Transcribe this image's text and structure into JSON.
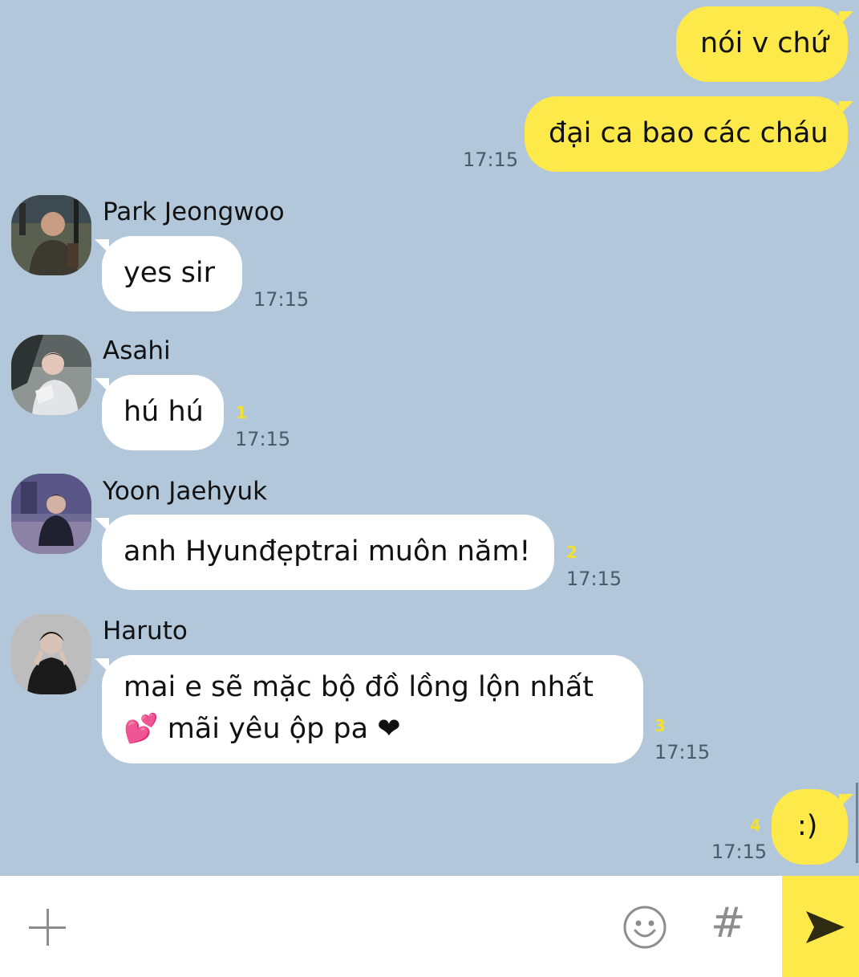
{
  "messages_out_top": [
    {
      "text": "nói v chứ"
    },
    {
      "text": "đại ca bao các cháu",
      "time": "17:15"
    }
  ],
  "incoming": [
    {
      "sender": "Park Jeongwoo",
      "text": "yes sir",
      "time": "17:15",
      "unread": ""
    },
    {
      "sender": "Asahi",
      "text": "hú hú",
      "time": "17:15",
      "unread": "1"
    },
    {
      "sender": "Yoon Jaehyuk",
      "text": "anh Hyunđẹptrai muôn năm!",
      "time": "17:15",
      "unread": "2"
    },
    {
      "sender": "Haruto",
      "line1": "mai e sẽ mặc bộ đồ lồng lộn nhất",
      "line2": "💕 mãi yêu ộp pa ❤",
      "time": "17:15",
      "unread": "3"
    }
  ],
  "last_out": {
    "text": ":)",
    "time": "17:15",
    "unread": "4"
  },
  "input_bar": {
    "add_icon": "plus-icon",
    "emoji_icon": "smiley-icon",
    "hash_symbol": "#",
    "send_icon": "send-arrow-icon"
  },
  "colors": {
    "background": "#b2c7da",
    "outgoing_bubble": "#fee94a",
    "incoming_bubble": "#ffffff",
    "unread_count": "#f4e02f"
  }
}
